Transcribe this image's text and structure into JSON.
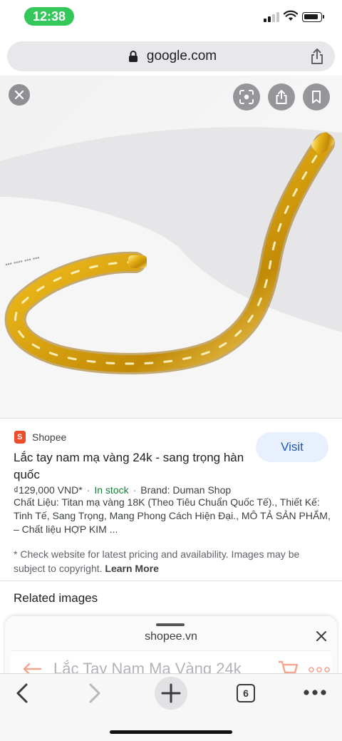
{
  "status_bar": {
    "time": "12:38"
  },
  "url_bar": {
    "domain": "google.com"
  },
  "result": {
    "source": "Shopee",
    "visit_label": "Visit",
    "title": "Lắc tay nam mạ vàng 24k - sang trọng hàn quốc",
    "price": "₫129,000 VND*",
    "stock": "In stock",
    "brand": "Brand: Duman Shop",
    "description": "Chất Liệu: Titan mạ vàng 18K (Theo Tiêu Chuẩn Quốc Tế)., Thiết Kế: Tinh Tế, Sang Trọng, Mang Phong Cách Hiện Đại., MÔ TẢ SẢN PHẨM, – Chất liệu HỢP KIM ...",
    "note": "* Check website for latest pricing and availability. Images may be subject to copyright.",
    "learn_more": "Learn More"
  },
  "related_label": "Related images",
  "sheet": {
    "domain": "shopee.vn",
    "page_title": "Lắc Tay Nam Mạ Vàng 24k"
  },
  "toolbar": {
    "tab_count": "6"
  },
  "colors": {
    "accent_green": "#34c759",
    "stock_green": "#188038",
    "visit_blue": "#1a56b8",
    "shopee_orange": "#ee4d2d"
  }
}
